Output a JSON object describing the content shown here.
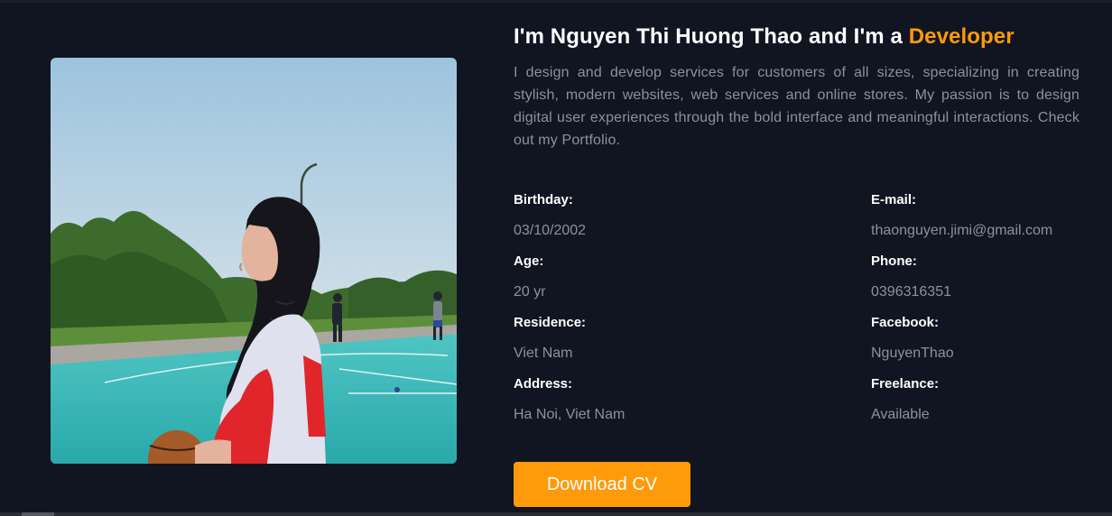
{
  "about": {
    "title_prefix": "I'm Nguyen Thi Huong Thao and I'm a ",
    "title_role": "Developer",
    "bio": "I design and develop services for customers of all sizes, specializing in creating stylish, modern websites, web services and online stores. My passion is to design digital user experiences through the bold interface and meaningful interactions. Check out my Portfolio.",
    "accent_color": "#ff9a0b"
  },
  "info": {
    "left": [
      {
        "label": "Birthday:",
        "value": "03/10/2002"
      },
      {
        "label": "Age:",
        "value": "20 yr"
      },
      {
        "label": "Residence:",
        "value": "Viet Nam"
      },
      {
        "label": "Address:",
        "value": "Ha Noi, Viet Nam"
      }
    ],
    "right": [
      {
        "label": "E-mail:",
        "value": "thaonguyen.jimi@gmail.com"
      },
      {
        "label": "Phone:",
        "value": "0396316351"
      },
      {
        "label": "Facebook:",
        "value": "NguyenThao"
      },
      {
        "label": "Freelance:",
        "value": "Available"
      }
    ]
  },
  "button": {
    "download_cv": "Download CV"
  },
  "photo": {
    "icon": "profile-photo"
  }
}
